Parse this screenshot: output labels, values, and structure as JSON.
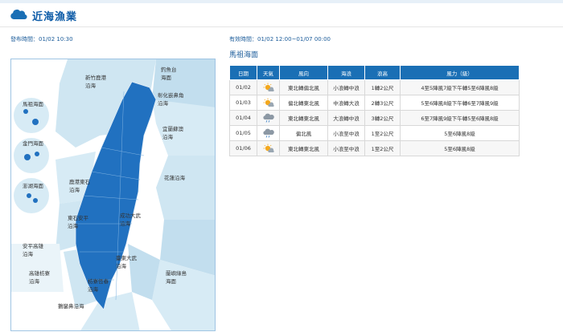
{
  "header": {
    "title": "近海漁業",
    "icon": "cloud-icon"
  },
  "issued": "發布時間：01/02 10:30",
  "valid": "有效時間：01/02 12:00~01/07 00:00",
  "area_title": "馬祖海面",
  "table": {
    "columns": [
      "日期",
      "天氣",
      "風向",
      "海浪",
      "浪高",
      "風力（級）"
    ],
    "rows": [
      {
        "date": "01/02",
        "weather": "sunny-cloudy-icon",
        "wind_dir": "東北轉偏北風",
        "wave": "小浪轉中浪",
        "height": "1轉2公尺",
        "force": "4至5陣風7級下午轉5至6陣風8級"
      },
      {
        "date": "01/03",
        "weather": "sunny-cloudy-icon",
        "wind_dir": "偏北轉東北風",
        "wave": "中浪轉大浪",
        "height": "2轉3公尺",
        "force": "5至6陣風8級下午轉6至7陣風9級"
      },
      {
        "date": "01/04",
        "weather": "cloudy-rain-icon",
        "wind_dir": "東北轉東北風",
        "wave": "大浪轉中浪",
        "height": "3轉2公尺",
        "force": "6至7陣風9級下午轉5至6陣風8級"
      },
      {
        "date": "01/05",
        "weather": "cloudy-rain-icon",
        "wind_dir": "偏北風",
        "wave": "小浪至中浪",
        "height": "1至2公尺",
        "force": "5至6陣風8級"
      },
      {
        "date": "01/06",
        "weather": "sunny-cloudy-icon",
        "wind_dir": "東北轉東北風",
        "wave": "小浪至中浪",
        "height": "1至2公尺",
        "force": "5至6陣風8級"
      }
    ]
  },
  "map": {
    "labels": {
      "hsinchu": "新竹鹿港\n沿海",
      "penghu_outer": "釣魚台\n海面",
      "keelung": "彰化嵌鼻角\n沿海",
      "matsu": "馬祖海面",
      "kinmen": "金門海面",
      "yilan": "宜蘭蘇澳\n沿海",
      "penghu": "澎湖海面",
      "lugang": "鹿港東石\n沿海",
      "hualien": "花蓮沿海",
      "dongshi": "東石安平\n沿海",
      "chenggong": "成功大武\n沿海",
      "anping": "安平高雄\n沿海",
      "taitung": "蘭嶼綠島\n海面",
      "dawu": "臺東大武\n沿海",
      "kaohsiung": "高雄枋寮\n沿海",
      "fangliao": "枋寮恆春\n沿海",
      "eluanbi": "鵝鑾鼻沿海"
    }
  },
  "colors": {
    "brand": "#0c5ba7",
    "table_header": "#1a6fb5",
    "land": "#2171c0",
    "sea": "#cbe5f1"
  }
}
